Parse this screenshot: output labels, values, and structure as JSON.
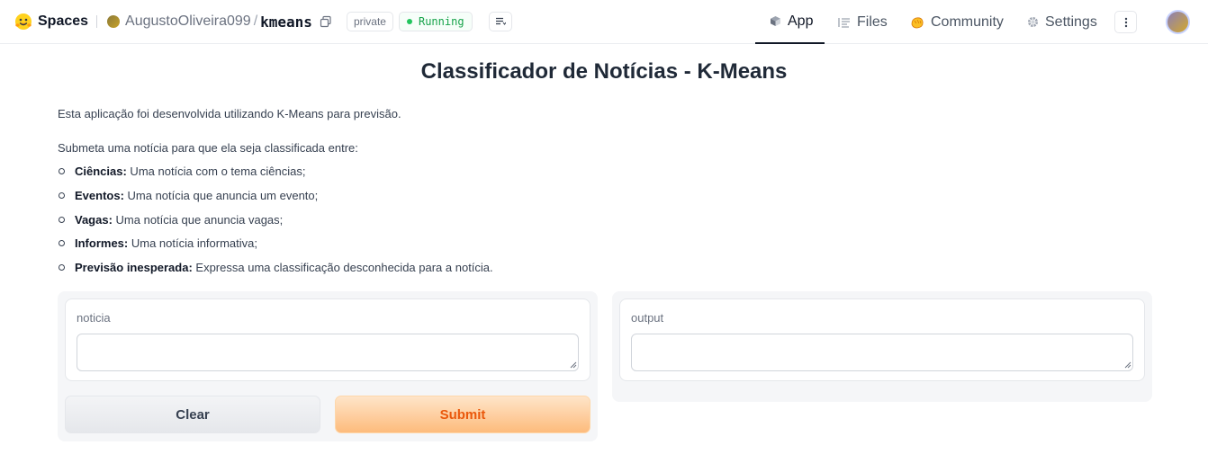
{
  "header": {
    "brand": "Spaces",
    "owner": "AugustoOliveira099",
    "separator": "/",
    "repo": "kmeans",
    "visibility": "private",
    "status": "Running",
    "tabs": [
      {
        "label": "App",
        "icon": "cube-icon",
        "active": true
      },
      {
        "label": "Files",
        "icon": "files-icon",
        "active": false
      },
      {
        "label": "Community",
        "icon": "hand-wave-icon",
        "active": false
      },
      {
        "label": "Settings",
        "icon": "gear-icon",
        "active": false
      }
    ]
  },
  "app": {
    "title": "Classificador de Notícias - K-Means",
    "intro": "Esta aplicação foi desenvolvida utilizando K-Means para previsão.",
    "instruction": "Submeta uma notícia para que ela seja classificada entre:",
    "categories": [
      {
        "name": "Ciências:",
        "description": " Uma notícia com o tema ciências;"
      },
      {
        "name": "Eventos:",
        "description": " Uma notícia que anuncia um evento;"
      },
      {
        "name": "Vagas:",
        "description": " Uma notícia que anuncia vagas;"
      },
      {
        "name": "Informes:",
        "description": " Uma notícia informativa;"
      },
      {
        "name": "Previsão inesperada:",
        "description": " Expressa uma classificação desconhecida para a notícia."
      }
    ],
    "input": {
      "label": "noticia",
      "value": ""
    },
    "output": {
      "label": "output",
      "value": ""
    },
    "buttons": {
      "clear": "Clear",
      "submit": "Submit"
    }
  },
  "colors": {
    "running_status": "#16a34a",
    "submit_text": "#ea580c",
    "submit_bg_top": "#fee5c9",
    "submit_bg_bottom": "#fdbb7c"
  }
}
